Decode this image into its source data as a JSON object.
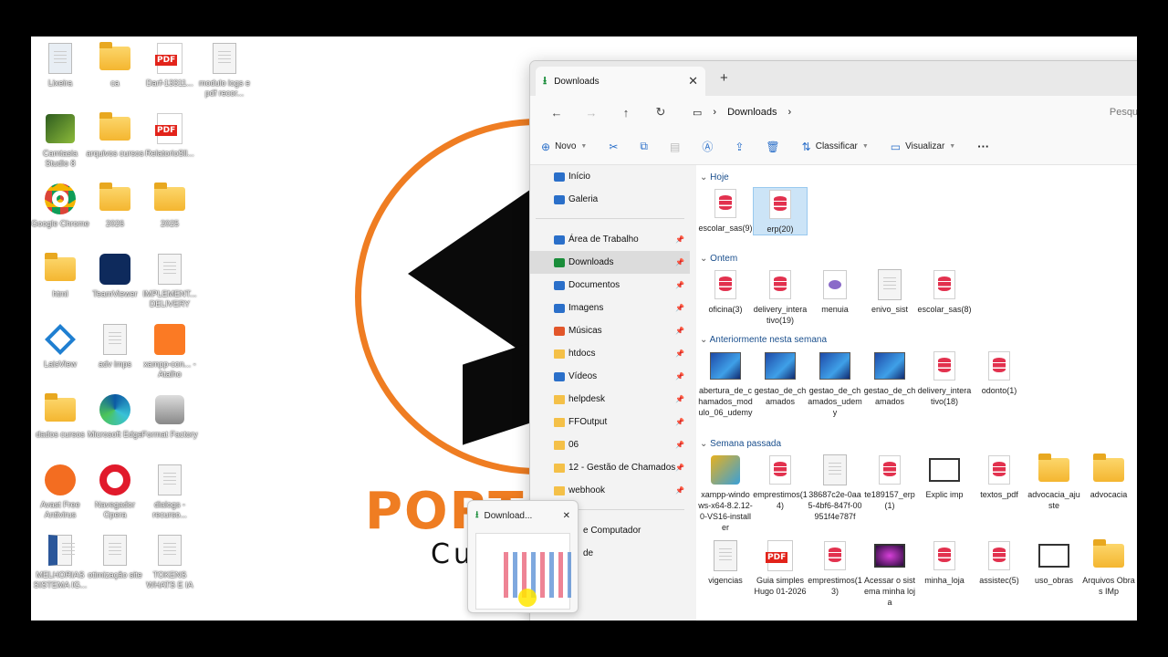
{
  "desktop": {
    "icons": [
      {
        "label": "Lixeira",
        "type": "recycle",
        "col": 0,
        "row": 0
      },
      {
        "label": "ca",
        "type": "folder",
        "col": 1,
        "row": 0
      },
      {
        "label": "Darf-13311...",
        "type": "pdf",
        "col": 2,
        "row": 0
      },
      {
        "label": "modulo logs e pdf recor...",
        "type": "file",
        "col": 3,
        "row": 0
      },
      {
        "label": "Camtasia Studio 8",
        "type": "app",
        "col": 0,
        "row": 1
      },
      {
        "label": "arquivos cursos",
        "type": "folder",
        "col": 1,
        "row": 1
      },
      {
        "label": "RelatorioSll...",
        "type": "pdf",
        "col": 2,
        "row": 1
      },
      {
        "label": "Google Chrome",
        "type": "chrome",
        "col": 0,
        "row": 2
      },
      {
        "label": "2026",
        "type": "folder",
        "col": 1,
        "row": 2
      },
      {
        "label": "2025",
        "type": "folder",
        "col": 2,
        "row": 2
      },
      {
        "label": "html",
        "type": "folder",
        "col": 0,
        "row": 3
      },
      {
        "label": "TeamViewer",
        "type": "teamviewer",
        "col": 1,
        "row": 3
      },
      {
        "label": "IMPLEMENT... DELIVERY",
        "type": "file",
        "col": 2,
        "row": 3
      },
      {
        "label": "LaisView",
        "type": "app2",
        "col": 0,
        "row": 4
      },
      {
        "label": "adv imps",
        "type": "file",
        "col": 1,
        "row": 4
      },
      {
        "label": "xampp-con... - Atalho",
        "type": "xampp",
        "col": 2,
        "row": 4
      },
      {
        "label": "dados cursos",
        "type": "folder",
        "col": 0,
        "row": 5
      },
      {
        "label": "Microsoft Edge",
        "type": "edge",
        "col": 1,
        "row": 5
      },
      {
        "label": "Format Factory",
        "type": "app3",
        "col": 2,
        "row": 5
      },
      {
        "label": "Avast Free Antivirus",
        "type": "avast",
        "col": 0,
        "row": 6
      },
      {
        "label": "Navegador Opera",
        "type": "opera",
        "col": 1,
        "row": 6
      },
      {
        "label": "dialogs - recurso...",
        "type": "file",
        "col": 2,
        "row": 6
      },
      {
        "label": "MELHORIAS SISTEMA IG...",
        "type": "word",
        "col": 0,
        "row": 7
      },
      {
        "label": "otimização site",
        "type": "file",
        "col": 1,
        "row": 7
      },
      {
        "label": "TOKENS WHATS E IA",
        "type": "file",
        "col": 2,
        "row": 7
      }
    ]
  },
  "wallpaper": {
    "text": "PORTAL",
    "sub": "Cur"
  },
  "explorer": {
    "tab_title": "Downloads",
    "new_tab": "+",
    "breadcrumb": "Downloads",
    "search_placeholder": "Pesquis",
    "toolbar": {
      "new": "Novo",
      "sort": "Classificar",
      "view": "Visualizar",
      "more": "···"
    },
    "nav": {
      "top": [
        {
          "label": "Início",
          "icon": "home-icon"
        },
        {
          "label": "Galeria",
          "icon": "gallery-icon"
        }
      ],
      "pinned": [
        {
          "label": "Área de Trabalho",
          "icon": "desktop-icon"
        },
        {
          "label": "Downloads",
          "icon": "download-icon",
          "selected": true
        },
        {
          "label": "Documentos",
          "icon": "documents-icon"
        },
        {
          "label": "Imagens",
          "icon": "pictures-icon"
        },
        {
          "label": "Músicas",
          "icon": "music-icon"
        },
        {
          "label": "htdocs",
          "icon": "folder-icon"
        },
        {
          "label": "Vídeos",
          "icon": "videos-icon"
        },
        {
          "label": "helpdesk",
          "icon": "folder-icon"
        },
        {
          "label": "FFOutput",
          "icon": "folder-icon"
        },
        {
          "label": "06",
          "icon": "folder-icon"
        },
        {
          "label": "12 - Gestão de Chamados",
          "icon": "folder-icon"
        },
        {
          "label": "webhook",
          "icon": "folder-icon"
        }
      ],
      "bottom": [
        {
          "label": "e Computador"
        },
        {
          "label": "de"
        }
      ]
    },
    "groups": [
      {
        "title": "Hoje",
        "files": [
          {
            "name": "escolar_sas(9)",
            "kind": "db"
          },
          {
            "name": "erp(20)",
            "kind": "db",
            "selected": true
          }
        ]
      },
      {
        "title": "Ontem",
        "files": [
          {
            "name": "oficina(3)",
            "kind": "db"
          },
          {
            "name": "delivery_interativo(19)",
            "kind": "db"
          },
          {
            "name": "menuia",
            "kind": "php"
          },
          {
            "name": "enivo_sist",
            "kind": "file"
          },
          {
            "name": "escolar_sas(8)",
            "kind": "db"
          }
        ]
      },
      {
        "title": "Anteriormente nesta semana",
        "files": [
          {
            "name": "abertura_de_chamados_modulo_06_udemy",
            "kind": "img"
          },
          {
            "name": "gestao_de_chamados",
            "kind": "img"
          },
          {
            "name": "gestao_de_chamados_udemy",
            "kind": "img"
          },
          {
            "name": "gestao_de_chamados",
            "kind": "img"
          },
          {
            "name": "delivery_interativo(18)",
            "kind": "db"
          },
          {
            "name": "odonto(1)",
            "kind": "db"
          }
        ]
      },
      {
        "title": "Semana passada",
        "files": [
          {
            "name": "xampp-windows-x64-8.2.12-0-VS16-installer",
            "kind": "exe"
          },
          {
            "name": "emprestimos(14)",
            "kind": "db"
          },
          {
            "name": "38687c2e-0aa5-4bf6-847f-00951f4e787f",
            "kind": "file"
          },
          {
            "name": "te189157_erp(1)",
            "kind": "db"
          },
          {
            "name": "Explic imp",
            "kind": "vid"
          },
          {
            "name": "textos_pdf",
            "kind": "db"
          },
          {
            "name": "advocacia_ajuste",
            "kind": "folder"
          },
          {
            "name": "advocacia",
            "kind": "folder"
          },
          {
            "name": "vigencias",
            "kind": "file"
          },
          {
            "name": "Guia simples Hugo 01-2026",
            "kind": "pdf"
          },
          {
            "name": "emprestimos(13)",
            "kind": "db"
          },
          {
            "name": "Acessar o sistema minha loja",
            "kind": "viddark"
          },
          {
            "name": "minha_loja",
            "kind": "db"
          },
          {
            "name": "assistec(5)",
            "kind": "db"
          },
          {
            "name": "uso_obras",
            "kind": "vid"
          },
          {
            "name": "Arquivos Obras IMp",
            "kind": "folder"
          }
        ]
      }
    ]
  },
  "thumbnail": {
    "title": "Download...",
    "close": "✕"
  }
}
